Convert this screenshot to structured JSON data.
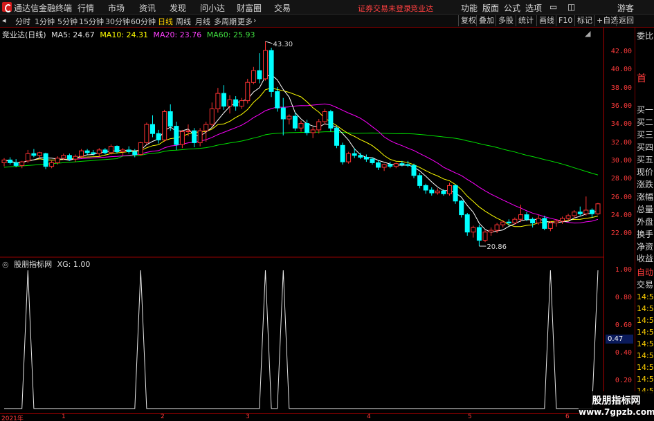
{
  "menubar": {
    "app_title": "通达信金融终端",
    "menus": [
      "行情",
      "市场",
      "资讯",
      "发现",
      "问小达",
      "财富圈",
      "交易"
    ],
    "status": "证券交易未登录",
    "stock": "竞业达",
    "right_menus": [
      "功能",
      "版面",
      "公式",
      "选项"
    ],
    "user": "游客"
  },
  "toolbar": {
    "periods": [
      "分时",
      "1分钟",
      "5分钟",
      "15分钟",
      "30分钟",
      "60分钟",
      "日线",
      "周线",
      "月线",
      "多周期",
      "更多"
    ],
    "active": "日线",
    "right_tools": [
      "复权",
      "叠加",
      "多股",
      "统计",
      "画线",
      "F10",
      "标记",
      "+自选",
      "返回"
    ]
  },
  "legend": {
    "title": "竞业达(日线)",
    "ma5": "MA5: 24.67",
    "ma10": "MA10: 24.31",
    "ma20": "MA20: 23.76",
    "ma60": "MA60: 25.93"
  },
  "indicator": {
    "name": "股朋指标网",
    "value": "XG: 1.00"
  },
  "annotations": {
    "high": "43.30",
    "low": "20.86"
  },
  "axis": {
    "price_labels": [
      "42.00",
      "40.00",
      "38.00",
      "36.00",
      "34.00",
      "32.00",
      "30.00",
      "28.00",
      "26.00",
      "24.00",
      "22.00"
    ],
    "ind_labels": [
      "1.00",
      "0.80",
      "0.60",
      "0.40",
      "0.20"
    ],
    "cursor_value": "0.47"
  },
  "sidepanel": {
    "items": [
      "委比",
      "首",
      "买一",
      "买二",
      "买三",
      "买四",
      "买五",
      "现价",
      "涨跌",
      "涨幅",
      "总量",
      "外盘",
      "换手",
      "净资",
      "收益",
      "自动",
      "交易",
      "14:5",
      "14:5",
      "14:5",
      "14:5",
      "14:5",
      "14:5",
      "14:5",
      "14:5",
      "14:5"
    ]
  },
  "dates": {
    "labels": [
      "2021年",
      "1",
      "2",
      "3",
      "4",
      "5",
      "6"
    ]
  },
  "watermark": {
    "line1": "股朋指标网",
    "line2": "www.7gpzb.com"
  },
  "colors": {
    "ma5": "#ffffff",
    "ma10": "#ffff00",
    "ma20": "#ff00ff",
    "ma60": "#00e000",
    "up": "#ff3232",
    "down": "#00ffff"
  },
  "chart_data": {
    "type": "candlestick",
    "title": "竞业达(日线)",
    "ylim": [
      21,
      43.5
    ],
    "candles": [
      [
        30.0,
        30.5,
        29.6,
        30.3
      ],
      [
        30.3,
        30.6,
        29.8,
        30.0
      ],
      [
        30.0,
        30.4,
        29.5,
        29.7
      ],
      [
        29.7,
        30.2,
        29.4,
        30.1
      ],
      [
        30.2,
        31.4,
        30.0,
        31.0
      ],
      [
        31.0,
        31.5,
        30.6,
        30.8
      ],
      [
        30.8,
        31.2,
        30.5,
        31.1
      ],
      [
        31.0,
        31.1,
        29.3,
        29.6
      ],
      [
        29.6,
        30.2,
        29.4,
        30.0
      ],
      [
        30.0,
        30.7,
        29.8,
        30.5
      ],
      [
        30.5,
        31.0,
        30.3,
        30.8
      ],
      [
        30.8,
        31.0,
        30.2,
        30.4
      ],
      [
        30.4,
        30.9,
        30.1,
        30.7
      ],
      [
        30.7,
        31.5,
        30.5,
        31.3
      ],
      [
        31.3,
        31.5,
        30.9,
        31.1
      ],
      [
        31.1,
        31.4,
        30.8,
        31.0
      ],
      [
        31.0,
        31.6,
        30.7,
        31.4
      ],
      [
        31.4,
        31.6,
        30.9,
        31.1
      ],
      [
        31.1,
        32.0,
        30.9,
        31.8
      ],
      [
        31.8,
        31.9,
        31.0,
        31.2
      ],
      [
        31.2,
        31.6,
        30.8,
        31.4
      ],
      [
        31.4,
        31.8,
        31.0,
        31.2
      ],
      [
        31.2,
        31.5,
        30.6,
        30.9
      ],
      [
        30.9,
        32.3,
        30.8,
        32.2
      ],
      [
        32.2,
        34.4,
        32.0,
        34.2
      ],
      [
        34.2,
        35.2,
        32.8,
        33.2
      ],
      [
        33.2,
        33.6,
        32.1,
        32.5
      ],
      [
        32.5,
        35.8,
        32.3,
        35.6
      ],
      [
        35.6,
        36.4,
        33.5,
        34.0
      ],
      [
        34.0,
        34.5,
        31.4,
        32.0
      ],
      [
        32.0,
        33.6,
        31.6,
        33.4
      ],
      [
        33.4,
        34.2,
        32.9,
        33.5
      ],
      [
        33.5,
        33.8,
        31.7,
        32.2
      ],
      [
        32.2,
        33.8,
        31.8,
        33.5
      ],
      [
        33.5,
        34.5,
        32.3,
        34.2
      ],
      [
        34.2,
        36.6,
        33.9,
        35.9
      ],
      [
        35.9,
        38.2,
        35.5,
        37.6
      ],
      [
        37.6,
        38.5,
        35.8,
        36.2
      ],
      [
        36.2,
        37.4,
        35.4,
        36.9
      ],
      [
        36.9,
        37.3,
        35.7,
        36.2
      ],
      [
        36.2,
        37.1,
        35.9,
        36.8
      ],
      [
        36.8,
        39.2,
        36.5,
        38.8
      ],
      [
        38.8,
        40.5,
        38.6,
        40.1
      ],
      [
        40.1,
        42.0,
        38.7,
        39.2
      ],
      [
        39.2,
        43.3,
        39.0,
        42.3
      ],
      [
        42.3,
        42.6,
        37.2,
        37.8
      ],
      [
        37.8,
        38.3,
        35.6,
        36.0
      ],
      [
        36.0,
        37.1,
        33.0,
        34.8
      ],
      [
        34.8,
        35.3,
        34.2,
        35.1
      ],
      [
        35.1,
        35.5,
        33.5,
        33.8
      ],
      [
        33.8,
        34.6,
        33.4,
        34.3
      ],
      [
        34.3,
        34.7,
        33.0,
        33.3
      ],
      [
        33.3,
        33.9,
        32.7,
        33.6
      ],
      [
        33.6,
        34.8,
        33.2,
        34.5
      ],
      [
        34.5,
        35.9,
        34.2,
        35.6
      ],
      [
        35.6,
        35.8,
        33.4,
        33.8
      ],
      [
        33.8,
        34.0,
        31.6,
        31.9
      ],
      [
        31.9,
        32.2,
        29.8,
        30.1
      ],
      [
        30.1,
        31.2,
        29.9,
        31.0
      ],
      [
        31.0,
        31.6,
        30.5,
        30.8
      ],
      [
        30.8,
        31.1,
        30.4,
        30.6
      ],
      [
        30.6,
        30.9,
        30.1,
        30.4
      ],
      [
        30.4,
        30.6,
        29.8,
        30.0
      ],
      [
        30.0,
        30.3,
        29.2,
        29.5
      ],
      [
        29.5,
        29.9,
        29.1,
        29.8
      ],
      [
        29.8,
        30.1,
        29.4,
        29.6
      ],
      [
        29.6,
        30.0,
        29.4,
        29.9
      ],
      [
        29.9,
        30.2,
        29.6,
        29.8
      ],
      [
        29.8,
        30.2,
        29.5,
        29.7
      ],
      [
        29.7,
        29.9,
        28.3,
        28.6
      ],
      [
        28.6,
        28.9,
        27.2,
        27.5
      ],
      [
        27.5,
        27.7,
        26.6,
        27.0
      ],
      [
        27.0,
        27.3,
        26.4,
        26.7
      ],
      [
        26.7,
        27.2,
        26.5,
        26.9
      ],
      [
        26.9,
        27.1,
        26.4,
        26.6
      ],
      [
        26.6,
        27.8,
        26.4,
        27.5
      ],
      [
        27.5,
        27.6,
        25.5,
        25.8
      ],
      [
        25.8,
        25.9,
        24.0,
        24.3
      ],
      [
        24.3,
        24.5,
        22.0,
        22.4
      ],
      [
        22.4,
        23.1,
        21.8,
        22.9
      ],
      [
        22.9,
        23.2,
        20.86,
        21.5
      ],
      [
        21.5,
        22.6,
        21.3,
        22.4
      ],
      [
        22.4,
        22.9,
        22.0,
        22.6
      ],
      [
        22.6,
        23.4,
        22.3,
        23.2
      ],
      [
        23.2,
        23.7,
        22.9,
        23.5
      ],
      [
        23.5,
        23.8,
        23.1,
        23.4
      ],
      [
        23.4,
        24.0,
        23.2,
        23.8
      ],
      [
        23.8,
        25.4,
        23.5,
        24.3
      ],
      [
        24.3,
        24.6,
        23.6,
        23.8
      ],
      [
        23.8,
        24.0,
        22.9,
        23.4
      ],
      [
        23.4,
        24.3,
        23.2,
        23.9
      ],
      [
        23.9,
        24.2,
        22.6,
        22.8
      ],
      [
        22.8,
        23.6,
        22.5,
        23.4
      ],
      [
        23.4,
        23.8,
        23.0,
        23.6
      ],
      [
        23.6,
        24.1,
        23.3,
        23.9
      ],
      [
        23.9,
        24.4,
        23.6,
        24.2
      ],
      [
        24.2,
        24.8,
        23.9,
        24.6
      ],
      [
        24.6,
        25.2,
        24.2,
        24.4
      ],
      [
        24.4,
        26.3,
        24.2,
        24.8
      ],
      [
        24.8,
        25.0,
        24.0,
        24.4
      ],
      [
        24.4,
        25.6,
        24.3,
        25.5
      ]
    ],
    "ma5_last": 24.67,
    "ma10_last": 24.31,
    "ma20_last": 23.76,
    "ma60_last": 25.93,
    "indicator_series": {
      "name": "XG",
      "ylim": [
        0,
        1
      ],
      "signal_indices": [
        4,
        23,
        44,
        47,
        92,
        100
      ]
    },
    "x_ticks": [
      {
        "label": "2021年",
        "index": 0
      },
      {
        "label": "1",
        "index": 13
      },
      {
        "label": "2",
        "index": 35
      },
      {
        "label": "3",
        "index": 54
      },
      {
        "label": "4",
        "index": 79
      },
      {
        "label": "5",
        "index": 101
      },
      {
        "label": "6",
        "index": 123
      }
    ]
  }
}
